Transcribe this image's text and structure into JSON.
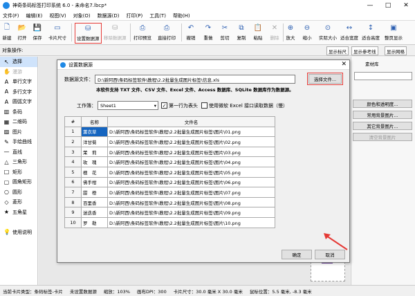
{
  "window": {
    "title": "神奇条码标签打印系统 6.0 - 未命名7.lbcp*",
    "min": "—",
    "max": "□",
    "close": "✕"
  },
  "menu": [
    "文件(F)",
    "编辑(E)",
    "视图(V)",
    "对象(O)",
    "数据源(D)",
    "打印(P)",
    "工具(T)",
    "帮助(H)"
  ],
  "toolbar": [
    {
      "label": "新建",
      "icon": "new-file-icon",
      "glyph": "🗋"
    },
    {
      "label": "打开",
      "icon": "open-folder-icon",
      "glyph": "📂"
    },
    {
      "label": "保存",
      "icon": "save-icon",
      "glyph": "💾"
    },
    {
      "label": "卡片尺寸",
      "icon": "card-size-icon",
      "glyph": "▭"
    },
    {
      "label": "设置数据源",
      "icon": "database-icon",
      "glyph": "⛁"
    },
    {
      "label": "移除数据源",
      "icon": "remove-database-icon",
      "glyph": "⛁"
    },
    {
      "label": "打印预览",
      "icon": "print-preview-icon",
      "glyph": "⎙"
    },
    {
      "label": "直接打印",
      "icon": "printer-icon",
      "glyph": "⎙"
    },
    {
      "label": "撤销",
      "icon": "undo-icon",
      "glyph": "↶"
    },
    {
      "label": "重做",
      "icon": "redo-icon",
      "glyph": "↷"
    },
    {
      "label": "剪切",
      "icon": "cut-icon",
      "glyph": "✂"
    },
    {
      "label": "复制",
      "icon": "copy-icon",
      "glyph": "⧉"
    },
    {
      "label": "粘贴",
      "icon": "paste-icon",
      "glyph": "📋"
    },
    {
      "label": "删除",
      "icon": "delete-icon",
      "glyph": "✕"
    },
    {
      "label": "放大",
      "icon": "zoom-in-icon",
      "glyph": "⊕"
    },
    {
      "label": "缩小",
      "icon": "zoom-out-icon",
      "glyph": "⊖"
    },
    {
      "label": "实际大小",
      "icon": "actual-size-icon",
      "glyph": "⊙"
    },
    {
      "label": "适合宽度",
      "icon": "fit-width-icon",
      "glyph": "↔"
    },
    {
      "label": "适合高度",
      "icon": "fit-height-icon",
      "glyph": "↕"
    },
    {
      "label": "整页显示",
      "icon": "full-page-icon",
      "glyph": "▣"
    }
  ],
  "objbar": {
    "label": "对象操作:"
  },
  "rtabs": [
    "显示标尺",
    "显示参考线",
    "显示网格"
  ],
  "sidebar": [
    {
      "label": "选择",
      "icon": "pointer-icon",
      "glyph": "↖"
    },
    {
      "label": "漫游",
      "icon": "hand-icon",
      "glyph": "✋"
    },
    {
      "label": "单行文字",
      "icon": "text-icon",
      "glyph": "A"
    },
    {
      "label": "多行文字",
      "icon": "multiline-text-icon",
      "glyph": "A"
    },
    {
      "label": "圆弧文字",
      "icon": "arc-text-icon",
      "glyph": "A"
    },
    {
      "label": "条码",
      "icon": "barcode-icon",
      "glyph": "▥"
    },
    {
      "label": "二维码",
      "icon": "qrcode-icon",
      "glyph": "▦"
    },
    {
      "label": "图片",
      "icon": "image-icon",
      "glyph": "▨"
    },
    {
      "label": "手绘曲线",
      "icon": "pen-icon",
      "glyph": "✎"
    },
    {
      "label": "直线",
      "icon": "line-icon",
      "glyph": "—"
    },
    {
      "label": "三角形",
      "icon": "triangle-icon",
      "glyph": "△"
    },
    {
      "label": "矩形",
      "icon": "rectangle-icon",
      "glyph": "□"
    },
    {
      "label": "圆角矩形",
      "icon": "rounded-rectangle-icon",
      "glyph": "▢"
    },
    {
      "label": "圆形",
      "icon": "circle-icon",
      "glyph": "○"
    },
    {
      "label": "菱形",
      "icon": "diamond-icon",
      "glyph": "◇"
    },
    {
      "label": "五角星",
      "icon": "star-icon",
      "glyph": "★"
    },
    {
      "label": "",
      "icon": "",
      "glyph": ""
    },
    {
      "label": "使用说明",
      "icon": "help-icon",
      "glyph": "💡"
    }
  ],
  "rpanel": {
    "tab": "素材库",
    "items": [
      "颜色和透明度...",
      "常用背景图片...",
      "其它背景图片...",
      "清空背景图片"
    ]
  },
  "status": [
    "当前卡片类型：条码标签-卡片",
    "未设置数据源",
    "缩放：103%",
    "画布DPI：300",
    "卡片尺寸：30.0 毫米 X 30.0 毫米",
    "鼠标位置：5.5 毫米, -8.3 毫米"
  ],
  "dialog": {
    "title": "设置数据源",
    "source_label": "数据源文件：",
    "source_path": "D:\\新阿西\\条码标签软件\\教程\\2.2批量生成图片标签\\信息.xls",
    "choose_btn": "选择文件...",
    "support_note": "本软件支持 TXT 文件、CSV 文件、Excel 文件、Access 数据库、SQLite 数据库作为数据源。",
    "sheet_label": "工作簿：",
    "sheet_value": "Sheet1",
    "first_row_label": "第一行为表头",
    "first_row_checked": "✓",
    "ms_excel_label": "使用微软 Excel 接口读取数据（慢）",
    "col_idx": "#",
    "col_name": "名称",
    "col_file": "文件名",
    "rows": [
      {
        "i": "1",
        "n": "薰衣草",
        "f": "D:\\新阿西\\条码标签软件\\教程\\2.2批量生成图片标签\\图片\\01.png"
      },
      {
        "i": "2",
        "n": "洋甘菊",
        "f": "D:\\新阿西\\条码标签软件\\教程\\2.2批量生成图片标签\\图片\\02.png"
      },
      {
        "i": "3",
        "n": "茉　莉",
        "f": "D:\\新阿西\\条码标签软件\\教程\\2.2批量生成图片标签\\图片\\03.png"
      },
      {
        "i": "4",
        "n": "玫　瑰",
        "f": "D:\\新阿西\\条码标签软件\\教程\\2.2批量生成图片标签\\图片\\04.png"
      },
      {
        "i": "5",
        "n": "檀　花",
        "f": "D:\\新阿西\\条码标签软件\\教程\\2.2批量生成图片标签\\图片\\05.png"
      },
      {
        "i": "6",
        "n": "佛手柑",
        "f": "D:\\新阿西\\条码标签软件\\教程\\2.2批量生成图片标签\\图片\\06.png"
      },
      {
        "i": "7",
        "n": "甜　橙",
        "f": "D:\\新阿西\\条码标签软件\\教程\\2.2批量生成图片标签\\图片\\07.png"
      },
      {
        "i": "8",
        "n": "百里香",
        "f": "D:\\新阿西\\条码标签软件\\教程\\2.2批量生成图片标签\\图片\\08.png"
      },
      {
        "i": "9",
        "n": "迷迭香",
        "f": "D:\\新阿西\\条码标签软件\\教程\\2.2批量生成图片标签\\图片\\09.png"
      },
      {
        "i": "10",
        "n": "罗　勒",
        "f": "D:\\新阿西\\条码标签软件\\教程\\2.2批量生成图片标签\\图片\\10.png"
      }
    ],
    "ok": "确定",
    "cancel": "取消"
  },
  "colors": {
    "accent": "#1565c0",
    "highlight": "#e53935"
  }
}
